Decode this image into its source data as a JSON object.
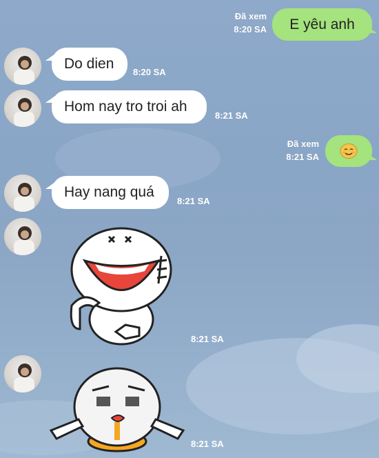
{
  "messages": {
    "m1": {
      "text": "E yêu anh",
      "seen": "Đã xem",
      "time": "8:20 SA"
    },
    "m2": {
      "text": "Do dien",
      "time": "8:20 SA"
    },
    "m3": {
      "text": "Hom nay tro troi ah",
      "time": "8:21 SA"
    },
    "m4": {
      "emoji": "😊",
      "seen": "Đã xem",
      "time": "8:21 SA"
    },
    "m5": {
      "text": "Hay nang quá",
      "time": "8:21 SA"
    },
    "m6": {
      "sticker": "laughing-sticker",
      "time": "8:21 SA"
    },
    "m7": {
      "sticker": "crying-sticker",
      "time": "8:21 SA"
    }
  },
  "colors": {
    "outgoing_bubble": "#a4e37d",
    "incoming_bubble": "#ffffff",
    "background": "#8ea9c9"
  }
}
